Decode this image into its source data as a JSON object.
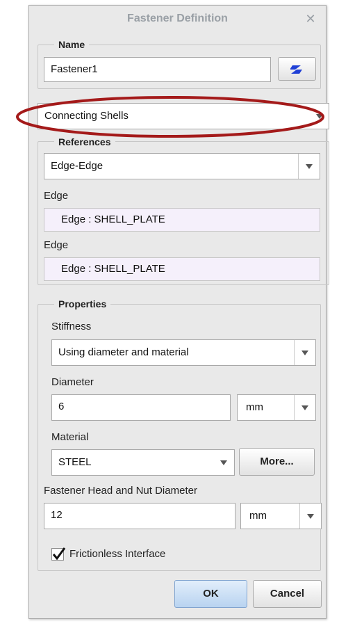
{
  "dialog": {
    "title": "Fastener Definition",
    "close_glyph": "✕"
  },
  "name_group": {
    "legend": "Name",
    "value": "Fastener1",
    "button_icon": "color-swatch-icon"
  },
  "type_select": {
    "value": "Connecting Shells"
  },
  "references": {
    "legend": "References",
    "select_value": "Edge-Edge",
    "edge1_label": "Edge",
    "edge1_value": "Edge : SHELL_PLATE",
    "edge2_label": "Edge",
    "edge2_value": "Edge : SHELL_PLATE"
  },
  "properties": {
    "legend": "Properties",
    "stiffness_label": "Stiffness",
    "stiffness_value": "Using diameter and material",
    "diameter_label": "Diameter",
    "diameter_value": "6",
    "diameter_unit": "mm",
    "material_label": "Material",
    "material_value": "STEEL",
    "more_label": "More...",
    "head_nut_label": "Fastener Head and Nut Diameter",
    "head_nut_value": "12",
    "head_nut_unit": "mm",
    "frictionless_label": "Frictionless Interface",
    "frictionless_checked": true
  },
  "footer": {
    "ok_label": "OK",
    "cancel_label": "Cancel"
  },
  "colors": {
    "annotation_ellipse": "#a41a1a",
    "swatch_blue": "#1f3fd6"
  }
}
